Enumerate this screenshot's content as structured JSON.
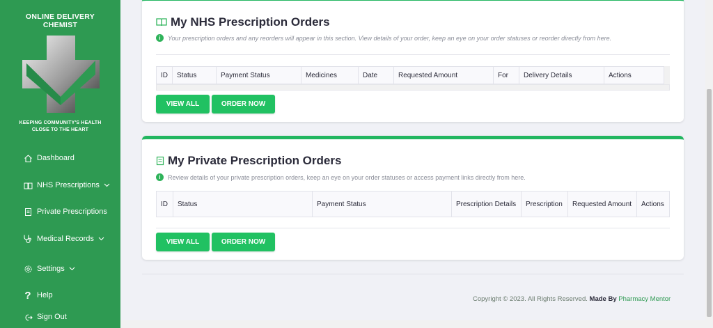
{
  "sidebar": {
    "brand_line1": "ONLINE DELIVERY",
    "brand_line2": "CHEMIST",
    "tagline_line1": "KEEPING COMMUNITY'S HEALTH",
    "tagline_line2": "CLOSE TO THE HEART",
    "items": [
      {
        "label": "Dashboard",
        "icon": "home-icon"
      },
      {
        "label": "NHS Prescriptions",
        "icon": "book-icon",
        "has_chevron": true
      },
      {
        "label": "Private Prescriptions",
        "icon": "document-icon"
      },
      {
        "label": "Medical Records",
        "icon": "stethoscope-icon",
        "has_chevron": true
      },
      {
        "label": "Settings",
        "icon": "gear-icon",
        "has_chevron": true
      },
      {
        "label": "Help",
        "icon": "question-icon"
      },
      {
        "label": "Sign Out",
        "icon": "sign-out-icon"
      }
    ]
  },
  "nhs": {
    "title": "My NHS Prescription Orders",
    "info": "Your prescription orders and any reorders will appear in this section. View details of your order, keep an eye on your order statuses or reorder directly from here.",
    "columns": [
      "ID",
      "Status",
      "Payment Status",
      "Medicines",
      "Date",
      "Requested Amount",
      "For",
      "Delivery Details",
      "Actions"
    ],
    "view_all": "VIEW ALL",
    "order_now": "ORDER NOW"
  },
  "private": {
    "title": "My Private Prescription Orders",
    "info": "Review details of your private prescription orders, keep an eye on your order statuses or access payment links directly from here.",
    "columns": [
      "ID",
      "Status",
      "Payment Status",
      "Prescription Details",
      "Prescription",
      "Requested Amount",
      "Actions"
    ],
    "view_all": "VIEW ALL",
    "order_now": "ORDER NOW"
  },
  "footer": {
    "copyright": "Copyright © 2023. All Rights Reserved.",
    "made_by": "Made By",
    "author": "Pharmacy Mentor"
  },
  "colors": {
    "sidebar": "#2e9a52",
    "accent": "#22b660",
    "button": "#21c162"
  }
}
